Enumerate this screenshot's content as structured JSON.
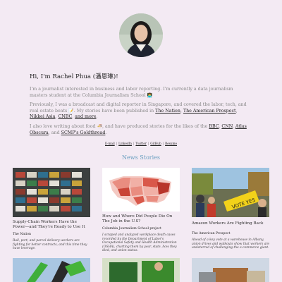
{
  "profile": {
    "greeting": "Hi, I'm Rachel Phua (潘恩琳)!",
    "p1": "I'm a journalist interested in business and labor reporting. I'm currently a data journalism masters student at the Columbia Journalism School",
    "p1_emoji": "👩‍💻",
    "p2_start": "Previously, I was a broadcast and digital reporter in Singapore, and covered the labor, tech, and real estate beats",
    "p2_emoji": "📝",
    "p2_mid": ". My stories have been published in",
    "outlets": [
      "The Nation",
      "The American Prospect",
      "Nikkei Asia",
      "CNBC"
    ],
    "and_more": "and more",
    "p3_start": "I also love writing about food",
    "p3_emoji": "🍜",
    "p3_mid": ", and have produced stories for the likes of the",
    "food_outlets": [
      "BBC",
      "CNN",
      "Atlas Obscura"
    ],
    "last_outlet": "SCMP's Goldthread"
  },
  "contact_links": [
    "E-mail",
    "LinkedIn",
    "Twitter",
    "GitHub",
    "Resume"
  ],
  "section_title": "News Stories",
  "stories": [
    {
      "title": "Supply-Chain Workers Have the Power—and They're Ready to Use It",
      "publication": "The Nation",
      "description": "Rail, port, and parcel delivery workers are fighting for better contracts, and this time they have leverage."
    },
    {
      "title": "How and Where Did People Die On The Job in the U.S?",
      "publication": "Columbia Journalism School project",
      "description": "I scraped and analyzed workplace death cases recorded by the Department of Labor's Occupational Safety and Health Administration (OSHA), charting them by year, state, how they died, and union status."
    },
    {
      "title": "Amazon Workers Are Fighting Back",
      "publication": "The American Prospect",
      "description": "Ahead of a key vote at a warehouse in Albany, union drives and walkouts show that workers are undeterred of challenging the e-commerce giant."
    }
  ],
  "colors": {
    "background": "#f3eaf3",
    "accent": "#6a9fc0"
  }
}
